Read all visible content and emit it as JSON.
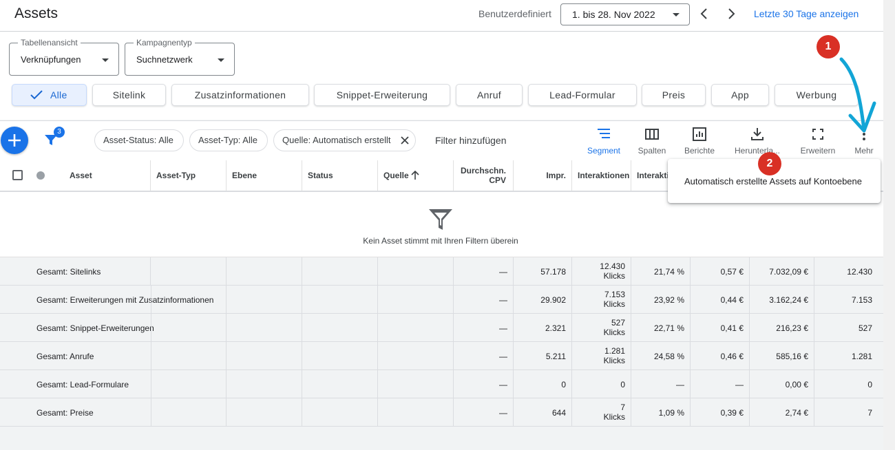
{
  "header": {
    "title": "Assets",
    "date_label": "Benutzerdefiniert",
    "date_value": "1. bis 28. Nov 2022",
    "last30_label": "Letzte 30 Tage anzeigen"
  },
  "selects": {
    "view": {
      "label": "Tabellenansicht",
      "value": "Verknüpfungen"
    },
    "campaign": {
      "label": "Kampagnentyp",
      "value": "Suchnetzwerk"
    }
  },
  "chips": [
    "Alle",
    "Sitelink",
    "Zusatzinformationen",
    "Snippet-Erweiterung",
    "Anruf",
    "Lead-Formular",
    "Preis",
    "App",
    "Werbung"
  ],
  "filters": {
    "badge_count": "3",
    "chips": [
      "Asset-Status: Alle",
      "Asset-Typ: Alle",
      "Quelle: Automatisch erstellt"
    ],
    "add_label": "Filter hinzufügen"
  },
  "toolbar": {
    "segment": "Segment",
    "columns": "Spalten",
    "reports": "Berichte",
    "download": "Herunterla...",
    "expand": "Erweitern",
    "more": "Mehr"
  },
  "table": {
    "headers": [
      "Asset",
      "Asset-Typ",
      "Ebene",
      "Status",
      "Quelle",
      "Durchschn.",
      "CPV",
      "Impr.",
      "Interaktionen",
      "Interakti"
    ],
    "empty_message": "Kein Asset stimmt mit Ihren Filtern überein",
    "rows": [
      {
        "name": "Gesamt: Sitelinks",
        "cpv": "—",
        "impr": "57.178",
        "inter": "12.430",
        "inter_unit": "Klicks",
        "rate": "21,74 %",
        "avg": "0,57 €",
        "cost": "7.032,09 €",
        "clicks": "12.430"
      },
      {
        "name": "Gesamt: Erweiterungen mit Zusatzinformationen",
        "cpv": "—",
        "impr": "29.902",
        "inter": "7.153",
        "inter_unit": "Klicks",
        "rate": "23,92 %",
        "avg": "0,44 €",
        "cost": "3.162,24 €",
        "clicks": "7.153"
      },
      {
        "name": "Gesamt: Snippet-Erweiterungen",
        "cpv": "—",
        "impr": "2.321",
        "inter": "527",
        "inter_unit": "Klicks",
        "rate": "22,71 %",
        "avg": "0,41 €",
        "cost": "216,23 €",
        "clicks": "527"
      },
      {
        "name": "Gesamt: Anrufe",
        "cpv": "—",
        "impr": "5.211",
        "inter": "1.281",
        "inter_unit": "Klicks",
        "rate": "24,58 %",
        "avg": "0,46 €",
        "cost": "585,16 €",
        "clicks": "1.281"
      },
      {
        "name": "Gesamt: Lead-Formulare",
        "cpv": "—",
        "impr": "0",
        "inter": "0",
        "inter_unit": "",
        "rate": "—",
        "avg": "—",
        "cost": "0,00 €",
        "clicks": "0"
      },
      {
        "name": "Gesamt: Preise",
        "cpv": "—",
        "impr": "644",
        "inter": "7",
        "inter_unit": "Klicks",
        "rate": "1,09 %",
        "avg": "0,39 €",
        "cost": "2,74 €",
        "clicks": "7"
      }
    ]
  },
  "menu": {
    "item": "Automatisch erstellte Assets auf Kontoebene"
  },
  "callouts": [
    "1",
    "2"
  ],
  "colors": {
    "accent": "#1a73e8",
    "callout": "#d93025",
    "arrow": "#12a5d6"
  }
}
